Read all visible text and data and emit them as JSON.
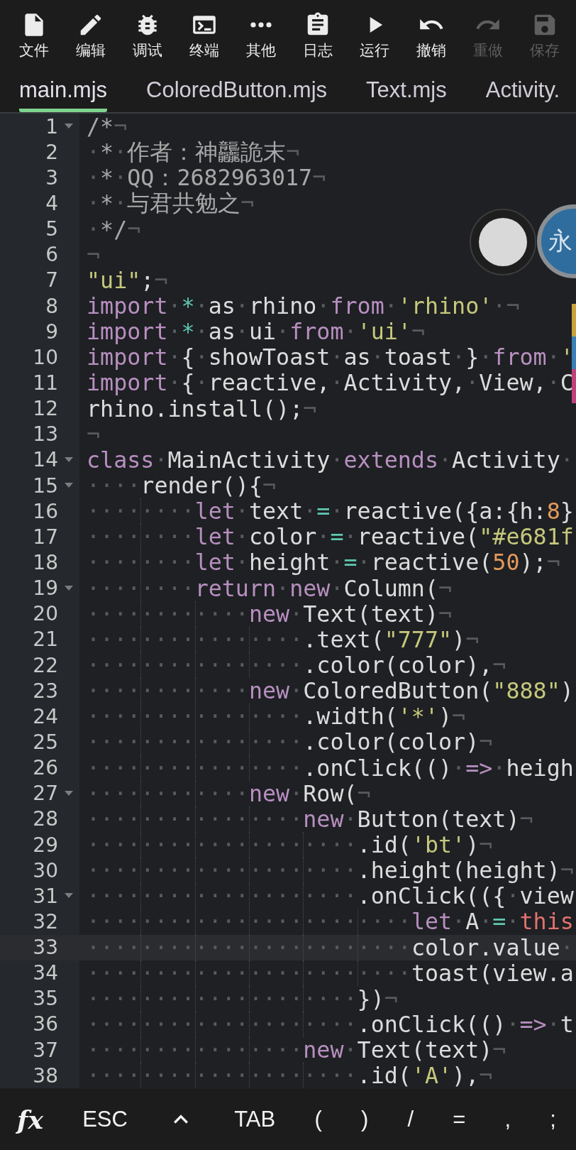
{
  "toolbar": [
    {
      "label": "文件",
      "disabled": false
    },
    {
      "label": "编辑",
      "disabled": false
    },
    {
      "label": "调试",
      "disabled": false
    },
    {
      "label": "终端",
      "disabled": false
    },
    {
      "label": "其他",
      "disabled": false
    },
    {
      "label": "日志",
      "disabled": false
    },
    {
      "label": "运行",
      "disabled": false
    },
    {
      "label": "撤销",
      "disabled": false
    },
    {
      "label": "重做",
      "disabled": true
    },
    {
      "label": "保存",
      "disabled": true
    }
  ],
  "tabs": [
    {
      "label": "main.mjs",
      "selected": true
    },
    {
      "label": "ColoredButton.mjs",
      "selected": false
    },
    {
      "label": "Text.mjs",
      "selected": false
    },
    {
      "label": "Activity.",
      "selected": false
    }
  ],
  "floating_badge": {
    "text": "永"
  },
  "lines": [
    {
      "number": "1",
      "fold": true,
      "current": false,
      "tokens": [
        {
          "kind": "cm",
          "text": "/*"
        },
        {
          "kind": "ws",
          "text": "¬"
        }
      ]
    },
    {
      "number": "2",
      "fold": false,
      "current": false,
      "tokens": [
        {
          "kind": "ws",
          "text": "·"
        },
        {
          "kind": "cm",
          "text": "*"
        },
        {
          "kind": "ws",
          "text": "·"
        },
        {
          "kind": "cm",
          "text": "作者：神龘詭末"
        },
        {
          "kind": "ws",
          "text": "¬"
        }
      ]
    },
    {
      "number": "3",
      "fold": false,
      "current": false,
      "tokens": [
        {
          "kind": "ws",
          "text": "·"
        },
        {
          "kind": "cm",
          "text": "*"
        },
        {
          "kind": "ws",
          "text": "·"
        },
        {
          "kind": "cm",
          "text": "QQ：2682963017"
        },
        {
          "kind": "ws",
          "text": "¬"
        }
      ]
    },
    {
      "number": "4",
      "fold": false,
      "current": false,
      "tokens": [
        {
          "kind": "ws",
          "text": "·"
        },
        {
          "kind": "cm",
          "text": "*"
        },
        {
          "kind": "ws",
          "text": "·"
        },
        {
          "kind": "cm",
          "text": "与君共勉之"
        },
        {
          "kind": "ws",
          "text": "¬"
        }
      ]
    },
    {
      "number": "5",
      "fold": false,
      "current": false,
      "tokens": [
        {
          "kind": "ws",
          "text": "·"
        },
        {
          "kind": "cm",
          "text": "*/"
        },
        {
          "kind": "ws",
          "text": "¬"
        }
      ]
    },
    {
      "number": "6",
      "fold": false,
      "current": false,
      "tokens": [
        {
          "kind": "ws",
          "text": "¬"
        }
      ]
    },
    {
      "number": "7",
      "fold": false,
      "current": false,
      "tokens": [
        {
          "kind": "str",
          "text": "\"ui\""
        },
        {
          "kind": "pl",
          "text": ";"
        },
        {
          "kind": "ws",
          "text": "¬"
        }
      ]
    },
    {
      "number": "8",
      "fold": false,
      "current": false,
      "tokens": [
        {
          "kind": "kw",
          "text": "import"
        },
        {
          "kind": "ws",
          "text": "·"
        },
        {
          "kind": "op",
          "text": "*"
        },
        {
          "kind": "ws",
          "text": "·"
        },
        {
          "kind": "pl",
          "text": "as"
        },
        {
          "kind": "ws",
          "text": "·"
        },
        {
          "kind": "pl",
          "text": "rhino"
        },
        {
          "kind": "ws",
          "text": "·"
        },
        {
          "kind": "kw",
          "text": "from"
        },
        {
          "kind": "ws",
          "text": "·"
        },
        {
          "kind": "str",
          "text": "'rhino'"
        },
        {
          "kind": "ws",
          "text": "·¬"
        }
      ]
    },
    {
      "number": "9",
      "fold": false,
      "current": false,
      "tokens": [
        {
          "kind": "kw",
          "text": "import"
        },
        {
          "kind": "ws",
          "text": "·"
        },
        {
          "kind": "op",
          "text": "*"
        },
        {
          "kind": "ws",
          "text": "·"
        },
        {
          "kind": "pl",
          "text": "as"
        },
        {
          "kind": "ws",
          "text": "·"
        },
        {
          "kind": "pl",
          "text": "ui"
        },
        {
          "kind": "ws",
          "text": "·"
        },
        {
          "kind": "kw",
          "text": "from"
        },
        {
          "kind": "ws",
          "text": "·"
        },
        {
          "kind": "str",
          "text": "'ui'"
        },
        {
          "kind": "ws",
          "text": "¬"
        }
      ]
    },
    {
      "number": "10",
      "fold": false,
      "current": false,
      "tokens": [
        {
          "kind": "kw",
          "text": "import"
        },
        {
          "kind": "ws",
          "text": "·"
        },
        {
          "kind": "pl",
          "text": "{"
        },
        {
          "kind": "ws",
          "text": "·"
        },
        {
          "kind": "pl",
          "text": "showToast"
        },
        {
          "kind": "ws",
          "text": "·"
        },
        {
          "kind": "pl",
          "text": "as"
        },
        {
          "kind": "ws",
          "text": "·"
        },
        {
          "kind": "pl",
          "text": "toast"
        },
        {
          "kind": "ws",
          "text": "·"
        },
        {
          "kind": "pl",
          "text": "}"
        },
        {
          "kind": "ws",
          "text": "·"
        },
        {
          "kind": "kw",
          "text": "from"
        },
        {
          "kind": "ws",
          "text": "·"
        },
        {
          "kind": "str",
          "text": "'"
        }
      ]
    },
    {
      "number": "11",
      "fold": false,
      "current": false,
      "tokens": [
        {
          "kind": "kw",
          "text": "import"
        },
        {
          "kind": "ws",
          "text": "·"
        },
        {
          "kind": "pl",
          "text": "{"
        },
        {
          "kind": "ws",
          "text": "·"
        },
        {
          "kind": "pl",
          "text": "reactive,"
        },
        {
          "kind": "ws",
          "text": "·"
        },
        {
          "kind": "pl",
          "text": "Activity,"
        },
        {
          "kind": "ws",
          "text": "·"
        },
        {
          "kind": "pl",
          "text": "View,"
        },
        {
          "kind": "ws",
          "text": "·"
        },
        {
          "kind": "pl",
          "text": "C"
        }
      ]
    },
    {
      "number": "12",
      "fold": false,
      "current": false,
      "tokens": [
        {
          "kind": "pl",
          "text": "rhino.install();"
        },
        {
          "kind": "ws",
          "text": "¬"
        }
      ]
    },
    {
      "number": "13",
      "fold": false,
      "current": false,
      "tokens": [
        {
          "kind": "ws",
          "text": "¬"
        }
      ]
    },
    {
      "number": "14",
      "fold": true,
      "current": false,
      "tokens": [
        {
          "kind": "kw",
          "text": "class"
        },
        {
          "kind": "ws",
          "text": "·"
        },
        {
          "kind": "pl",
          "text": "MainActivity"
        },
        {
          "kind": "ws",
          "text": "·"
        },
        {
          "kind": "kw",
          "text": "extends"
        },
        {
          "kind": "ws",
          "text": "·"
        },
        {
          "kind": "pl",
          "text": "Activity"
        },
        {
          "kind": "ws",
          "text": "·"
        }
      ]
    },
    {
      "number": "15",
      "fold": true,
      "current": false,
      "tokens": [
        {
          "kind": "ws",
          "text": "····"
        },
        {
          "kind": "pl",
          "text": "render(){"
        },
        {
          "kind": "ws",
          "text": "¬"
        }
      ]
    },
    {
      "number": "16",
      "fold": false,
      "current": false,
      "tokens": [
        {
          "kind": "ws",
          "text": "········"
        },
        {
          "kind": "kw",
          "text": "let"
        },
        {
          "kind": "ws",
          "text": "·"
        },
        {
          "kind": "pl",
          "text": "text"
        },
        {
          "kind": "ws",
          "text": "·"
        },
        {
          "kind": "op",
          "text": "="
        },
        {
          "kind": "ws",
          "text": "·"
        },
        {
          "kind": "pl",
          "text": "reactive({a:{h:"
        },
        {
          "kind": "num",
          "text": "8"
        },
        {
          "kind": "pl",
          "text": "}"
        }
      ]
    },
    {
      "number": "17",
      "fold": false,
      "current": false,
      "tokens": [
        {
          "kind": "ws",
          "text": "········"
        },
        {
          "kind": "kw",
          "text": "let"
        },
        {
          "kind": "ws",
          "text": "·"
        },
        {
          "kind": "pl",
          "text": "color"
        },
        {
          "kind": "ws",
          "text": "·"
        },
        {
          "kind": "op",
          "text": "="
        },
        {
          "kind": "ws",
          "text": "·"
        },
        {
          "kind": "pl",
          "text": "reactive("
        },
        {
          "kind": "str",
          "text": "\"#e681f"
        }
      ]
    },
    {
      "number": "18",
      "fold": false,
      "current": false,
      "tokens": [
        {
          "kind": "ws",
          "text": "········"
        },
        {
          "kind": "kw",
          "text": "let"
        },
        {
          "kind": "ws",
          "text": "·"
        },
        {
          "kind": "pl",
          "text": "height"
        },
        {
          "kind": "ws",
          "text": "·"
        },
        {
          "kind": "op",
          "text": "="
        },
        {
          "kind": "ws",
          "text": "·"
        },
        {
          "kind": "pl",
          "text": "reactive("
        },
        {
          "kind": "num",
          "text": "50"
        },
        {
          "kind": "pl",
          "text": ");"
        },
        {
          "kind": "ws",
          "text": "¬"
        }
      ]
    },
    {
      "number": "19",
      "fold": true,
      "current": false,
      "tokens": [
        {
          "kind": "ws",
          "text": "········"
        },
        {
          "kind": "kw",
          "text": "return"
        },
        {
          "kind": "ws",
          "text": "·"
        },
        {
          "kind": "kw",
          "text": "new"
        },
        {
          "kind": "ws",
          "text": "·"
        },
        {
          "kind": "pl",
          "text": "Column("
        },
        {
          "kind": "ws",
          "text": "¬"
        }
      ]
    },
    {
      "number": "20",
      "fold": false,
      "current": false,
      "tokens": [
        {
          "kind": "ws",
          "text": "············"
        },
        {
          "kind": "kw",
          "text": "new"
        },
        {
          "kind": "ws",
          "text": "·"
        },
        {
          "kind": "pl",
          "text": "Text(text)"
        },
        {
          "kind": "ws",
          "text": "¬"
        }
      ]
    },
    {
      "number": "21",
      "fold": false,
      "current": false,
      "tokens": [
        {
          "kind": "ws",
          "text": "················"
        },
        {
          "kind": "pl",
          "text": ".text("
        },
        {
          "kind": "str",
          "text": "\"777\""
        },
        {
          "kind": "pl",
          "text": ")"
        },
        {
          "kind": "ws",
          "text": "¬"
        }
      ]
    },
    {
      "number": "22",
      "fold": false,
      "current": false,
      "tokens": [
        {
          "kind": "ws",
          "text": "················"
        },
        {
          "kind": "pl",
          "text": ".color(color),"
        },
        {
          "kind": "ws",
          "text": "¬"
        }
      ]
    },
    {
      "number": "23",
      "fold": false,
      "current": false,
      "tokens": [
        {
          "kind": "ws",
          "text": "············"
        },
        {
          "kind": "kw",
          "text": "new"
        },
        {
          "kind": "ws",
          "text": "·"
        },
        {
          "kind": "pl",
          "text": "ColoredButton("
        },
        {
          "kind": "str",
          "text": "\"888\""
        },
        {
          "kind": "pl",
          "text": ")"
        }
      ]
    },
    {
      "number": "24",
      "fold": false,
      "current": false,
      "tokens": [
        {
          "kind": "ws",
          "text": "················"
        },
        {
          "kind": "pl",
          "text": ".width("
        },
        {
          "kind": "str",
          "text": "'*'"
        },
        {
          "kind": "pl",
          "text": ")"
        },
        {
          "kind": "ws",
          "text": "¬"
        }
      ]
    },
    {
      "number": "25",
      "fold": false,
      "current": false,
      "tokens": [
        {
          "kind": "ws",
          "text": "················"
        },
        {
          "kind": "pl",
          "text": ".color(color)"
        },
        {
          "kind": "ws",
          "text": "¬"
        }
      ]
    },
    {
      "number": "26",
      "fold": false,
      "current": false,
      "tokens": [
        {
          "kind": "ws",
          "text": "················"
        },
        {
          "kind": "pl",
          "text": ".onClick(()"
        },
        {
          "kind": "ws",
          "text": "·"
        },
        {
          "kind": "kw",
          "text": "=>"
        },
        {
          "kind": "ws",
          "text": "·"
        },
        {
          "kind": "pl",
          "text": "heigh"
        }
      ]
    },
    {
      "number": "27",
      "fold": true,
      "current": false,
      "tokens": [
        {
          "kind": "ws",
          "text": "············"
        },
        {
          "kind": "kw",
          "text": "new"
        },
        {
          "kind": "ws",
          "text": "·"
        },
        {
          "kind": "pl",
          "text": "Row("
        },
        {
          "kind": "ws",
          "text": "¬"
        }
      ]
    },
    {
      "number": "28",
      "fold": false,
      "current": false,
      "tokens": [
        {
          "kind": "ws",
          "text": "················"
        },
        {
          "kind": "kw",
          "text": "new"
        },
        {
          "kind": "ws",
          "text": "·"
        },
        {
          "kind": "pl",
          "text": "Button(text)"
        },
        {
          "kind": "ws",
          "text": "¬"
        }
      ]
    },
    {
      "number": "29",
      "fold": false,
      "current": false,
      "tokens": [
        {
          "kind": "ws",
          "text": "····················"
        },
        {
          "kind": "pl",
          "text": ".id("
        },
        {
          "kind": "str",
          "text": "'bt'"
        },
        {
          "kind": "pl",
          "text": ")"
        },
        {
          "kind": "ws",
          "text": "¬"
        }
      ]
    },
    {
      "number": "30",
      "fold": false,
      "current": false,
      "tokens": [
        {
          "kind": "ws",
          "text": "····················"
        },
        {
          "kind": "pl",
          "text": ".height(height)"
        },
        {
          "kind": "ws",
          "text": "¬"
        }
      ]
    },
    {
      "number": "31",
      "fold": true,
      "current": false,
      "tokens": [
        {
          "kind": "ws",
          "text": "····················"
        },
        {
          "kind": "pl",
          "text": ".onClick(({"
        },
        {
          "kind": "ws",
          "text": "·"
        },
        {
          "kind": "pl",
          "text": "view"
        }
      ]
    },
    {
      "number": "32",
      "fold": false,
      "current": false,
      "tokens": [
        {
          "kind": "ws",
          "text": "························"
        },
        {
          "kind": "kw",
          "text": "let"
        },
        {
          "kind": "ws",
          "text": "·"
        },
        {
          "kind": "pl",
          "text": "A"
        },
        {
          "kind": "ws",
          "text": "·"
        },
        {
          "kind": "op",
          "text": "="
        },
        {
          "kind": "ws",
          "text": "·"
        },
        {
          "kind": "this",
          "text": "this"
        }
      ]
    },
    {
      "number": "33",
      "fold": false,
      "current": true,
      "tokens": [
        {
          "kind": "ws",
          "text": "························"
        },
        {
          "kind": "pl",
          "text": "color.value"
        },
        {
          "kind": "ws",
          "text": "·"
        }
      ]
    },
    {
      "number": "34",
      "fold": false,
      "current": false,
      "tokens": [
        {
          "kind": "ws",
          "text": "························"
        },
        {
          "kind": "pl",
          "text": "toast(view.a"
        }
      ]
    },
    {
      "number": "35",
      "fold": false,
      "current": false,
      "tokens": [
        {
          "kind": "ws",
          "text": "····················"
        },
        {
          "kind": "pl",
          "text": "})"
        },
        {
          "kind": "ws",
          "text": "¬"
        }
      ]
    },
    {
      "number": "36",
      "fold": false,
      "current": false,
      "tokens": [
        {
          "kind": "ws",
          "text": "····················"
        },
        {
          "kind": "pl",
          "text": ".onClick(()"
        },
        {
          "kind": "ws",
          "text": "·"
        },
        {
          "kind": "kw",
          "text": "=>"
        },
        {
          "kind": "ws",
          "text": "·"
        },
        {
          "kind": "pl",
          "text": "t"
        }
      ]
    },
    {
      "number": "37",
      "fold": false,
      "current": false,
      "tokens": [
        {
          "kind": "ws",
          "text": "················"
        },
        {
          "kind": "kw",
          "text": "new"
        },
        {
          "kind": "ws",
          "text": "·"
        },
        {
          "kind": "pl",
          "text": "Text(text)"
        },
        {
          "kind": "ws",
          "text": "¬"
        }
      ]
    },
    {
      "number": "38",
      "fold": false,
      "current": false,
      "tokens": [
        {
          "kind": "ws",
          "text": "····················"
        },
        {
          "kind": "pl",
          "text": ".id("
        },
        {
          "kind": "str",
          "text": "'A'"
        },
        {
          "kind": "pl",
          "text": "),"
        },
        {
          "kind": "ws",
          "text": "¬"
        }
      ]
    }
  ],
  "keys": [
    {
      "kind": "fx",
      "label": "fx"
    },
    {
      "kind": "text",
      "label": "ESC"
    },
    {
      "kind": "caret"
    },
    {
      "kind": "text",
      "label": "TAB"
    },
    {
      "kind": "text",
      "label": "("
    },
    {
      "kind": "text",
      "label": ")"
    },
    {
      "kind": "text",
      "label": "/"
    },
    {
      "kind": "text",
      "label": "="
    },
    {
      "kind": "text",
      "label": ","
    },
    {
      "kind": "text",
      "label": ";"
    }
  ]
}
